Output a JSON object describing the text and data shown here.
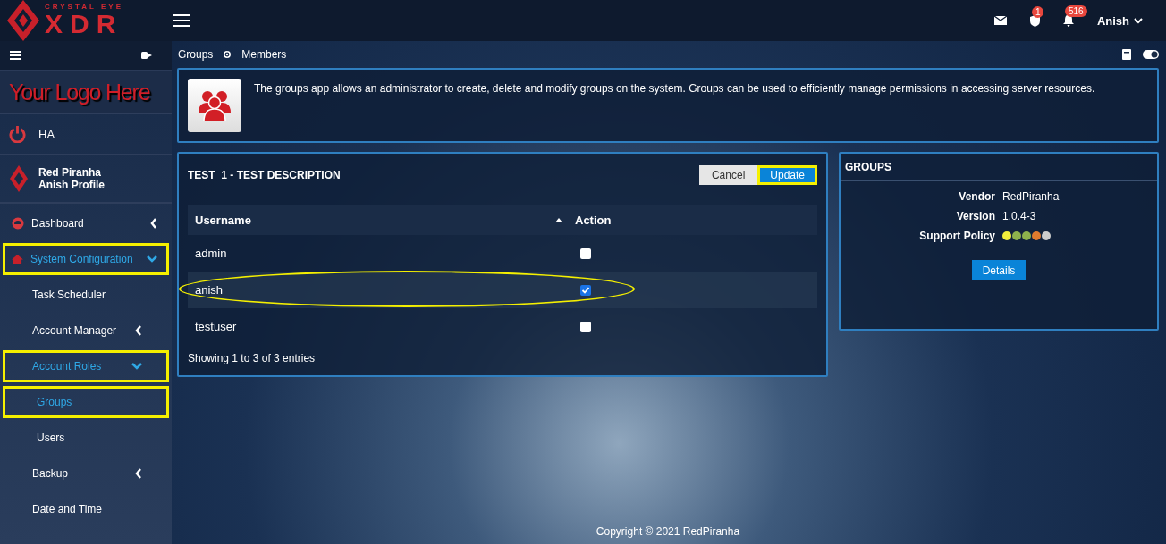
{
  "brand": {
    "tagline": "CRYSTAL EYE",
    "name": "XDR"
  },
  "topbar": {
    "notifications": [
      {
        "kind": "mail"
      },
      {
        "kind": "shield",
        "badge": "1"
      },
      {
        "kind": "bell",
        "badge": "516"
      }
    ],
    "user": "Anish"
  },
  "sidebar": {
    "logo_text": "Your Logo Here",
    "ha_label": "HA",
    "profile": {
      "name": "Red Piranha",
      "subtitle": "Anish Profile"
    },
    "items": [
      {
        "label": "Dashboard",
        "kind": "section",
        "expanded": false,
        "active": false,
        "highlighted": false
      },
      {
        "label": "System Configuration",
        "kind": "section",
        "expanded": true,
        "active": true,
        "highlighted": true
      },
      {
        "label": "Task Scheduler",
        "kind": "sub",
        "active": false,
        "highlighted": false
      },
      {
        "label": "Account Manager",
        "kind": "sub",
        "expanded": false,
        "active": false,
        "highlighted": false
      },
      {
        "label": "Account Roles",
        "kind": "sub",
        "expanded": true,
        "active": true,
        "highlighted": true
      },
      {
        "label": "Groups",
        "kind": "leaf",
        "active": true,
        "highlighted": true
      },
      {
        "label": "Users",
        "kind": "leaf",
        "active": false,
        "highlighted": false
      },
      {
        "label": "Backup",
        "kind": "sub",
        "expanded": false,
        "active": false,
        "highlighted": false
      },
      {
        "label": "Date and Time",
        "kind": "sub",
        "active": false,
        "highlighted": false
      }
    ]
  },
  "breadcrumb": [
    "Groups",
    "Members"
  ],
  "info": {
    "text": "The groups app allows an administrator to create, delete and modify groups on the system. Groups can be used to efficiently manage permissions in accessing server resources."
  },
  "members_panel": {
    "title": "TEST_1 - TEST DESCRIPTION",
    "buttons": [
      {
        "label": "Cancel",
        "kind": "default",
        "highlighted": false
      },
      {
        "label": "Update",
        "kind": "primary",
        "highlighted": true
      }
    ],
    "table": {
      "columns": [
        "Username",
        "Action"
      ],
      "rows": [
        {
          "username": "admin",
          "checked": false,
          "circled": false
        },
        {
          "username": "anish",
          "checked": true,
          "circled": true
        },
        {
          "username": "testuser",
          "checked": false,
          "circled": false
        }
      ]
    },
    "footer": "Showing 1 to 3 of 3 entries"
  },
  "groups_panel": {
    "title": "GROUPS",
    "fields": [
      {
        "label": "Vendor",
        "value": "RedPiranha"
      },
      {
        "label": "Version",
        "value": "1.0.4-3"
      }
    ],
    "support_label": "Support Policy",
    "support_dots": [
      {
        "color": "#f2ef3c"
      },
      {
        "color": "#8db24c"
      },
      {
        "color": "#8db24c"
      },
      {
        "color": "#e07b2e"
      },
      {
        "color": "#cccccc"
      }
    ],
    "button": "Details"
  },
  "footer": "Copyright © 2021 RedPiranha"
}
